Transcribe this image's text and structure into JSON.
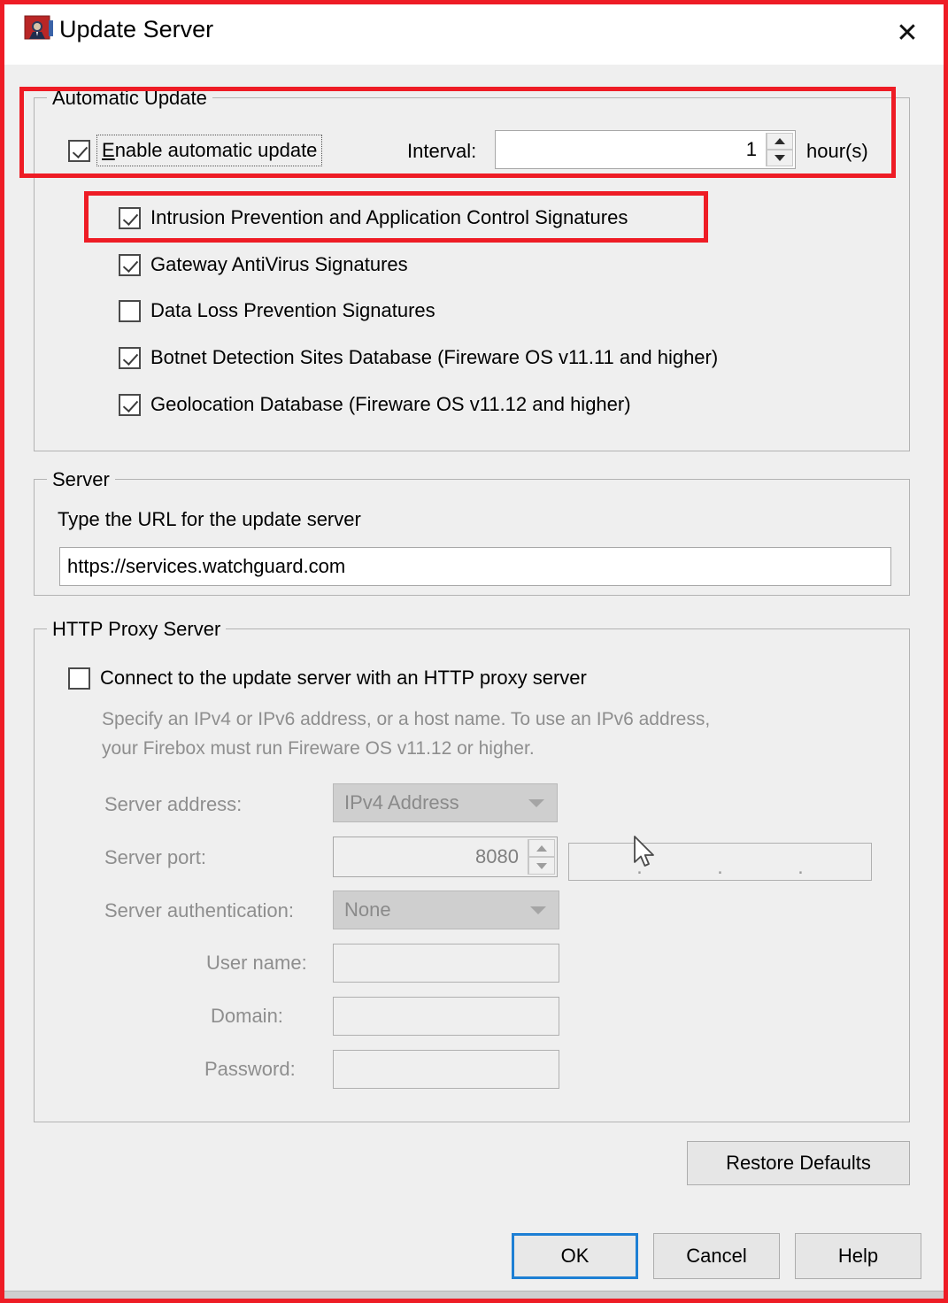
{
  "window": {
    "title": "Update Server",
    "icon": "watchguard-app-icon",
    "close_label": "✕"
  },
  "automatic_update": {
    "group_title": "Automatic Update",
    "enable_checkbox": {
      "label_prefix": "E",
      "label_rest": "nable automatic update",
      "label_full": "Enable automatic update",
      "checked": true
    },
    "interval": {
      "label": "Interval:",
      "value": "1",
      "units": "hour(s)"
    },
    "signature_items": [
      {
        "label": "Intrusion Prevention and Application Control Signatures",
        "checked": true
      },
      {
        "label": "Gateway AntiVirus Signatures",
        "checked": true
      },
      {
        "label": "Data Loss Prevention Signatures",
        "checked": false
      },
      {
        "label": "Botnet Detection Sites Database (Fireware OS v11.11 and higher)",
        "checked": true
      },
      {
        "label": "Geolocation Database (Fireware OS v11.12 and higher)",
        "checked": true
      }
    ]
  },
  "server": {
    "group_title": "Server",
    "instruction": "Type the URL for the update server",
    "url_value": "https://services.watchguard.com"
  },
  "http_proxy": {
    "group_title": "HTTP Proxy Server",
    "enable_checkbox": {
      "label": "Connect to the update server with an HTTP proxy server",
      "checked": false
    },
    "help_line_1": "Specify an IPv4 or IPv6 address, or a host name. To use an IPv6 address,",
    "help_line_2": "your Firebox must run Fireware OS v11.12 or higher.",
    "server_address": {
      "label": "Server address:",
      "type_value": "IPv4 Address",
      "ip_value": ""
    },
    "server_port": {
      "label": "Server port:",
      "value": "8080"
    },
    "server_authentication": {
      "label": "Server authentication:",
      "value": "None"
    },
    "user_name": {
      "label": "User name:",
      "value": ""
    },
    "domain": {
      "label": "Domain:",
      "value": ""
    },
    "password": {
      "label": "Password:",
      "value": ""
    }
  },
  "buttons": {
    "restore_defaults": "Restore Defaults",
    "ok": "OK",
    "cancel": "Cancel",
    "help": "Help"
  },
  "colors": {
    "annotation_red": "#ee1c25",
    "focus_blue": "#1d7fd4",
    "dialog_bg": "#efefef"
  }
}
